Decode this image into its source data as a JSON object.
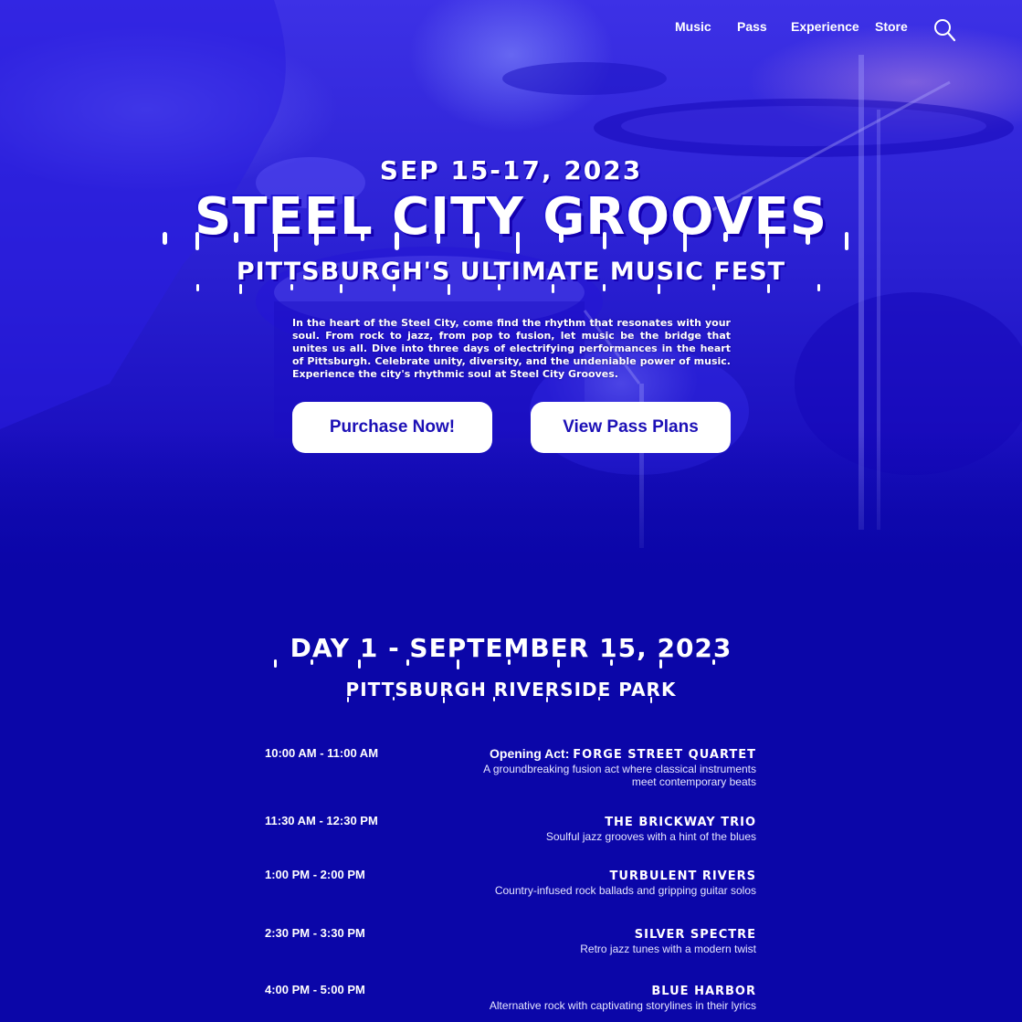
{
  "nav": {
    "links": [
      "Music",
      "Pass",
      "Experience",
      "Store"
    ],
    "search_icon": "search-icon"
  },
  "hero": {
    "date": "SEP 15-17, 2023",
    "title": "STEEL CITY GROOVES",
    "subtitle": "PITTSBURGH'S ULTIMATE MUSIC FEST",
    "description": "In the heart of the Steel City, come find the rhythm that resonates with your soul. From rock to jazz, from pop to fusion, let music be the bridge that unites us all. Dive into three days of electrifying performances in the heart of Pittsburgh. Celebrate unity, diversity, and the undeniable power of music. Experience the city's rhythmic soul at Steel City Grooves.",
    "buttons": {
      "purchase": "Purchase Now!",
      "pass_plans": "View Pass Plans"
    }
  },
  "schedule": {
    "day_title": "DAY 1 - SEPTEMBER 15, 2023",
    "venue": "PITTSBURGH RIVERSIDE PARK",
    "slots": [
      {
        "time": "10:00 AM - 11:00 AM",
        "prefix": "Opening Act: ",
        "artist": "FORGE STREET QUARTET",
        "description": "A groundbreaking fusion act where classical instruments meet contemporary beats"
      },
      {
        "time": "11:30 AM - 12:30 PM",
        "prefix": "",
        "artist": "THE BRICKWAY TRIO",
        "description": "Soulful jazz grooves with a hint of the blues"
      },
      {
        "time": "1:00 PM - 2:00 PM",
        "prefix": "",
        "artist": "TURBULENT RIVERS",
        "description": "Country-infused rock ballads and gripping guitar solos"
      },
      {
        "time": "2:30 PM - 3:30 PM",
        "prefix": "",
        "artist": "SILVER SPECTRE",
        "description": "Retro jazz tunes with a modern twist"
      },
      {
        "time": "4:00 PM - 5:00 PM",
        "prefix": "",
        "artist": "BLUE HARBOR",
        "description": "Alternative rock with captivating storylines in their lyrics"
      }
    ]
  },
  "colors": {
    "background": "#0b06a8",
    "button_text": "#1c10b6",
    "button_bg": "#ffffff"
  }
}
